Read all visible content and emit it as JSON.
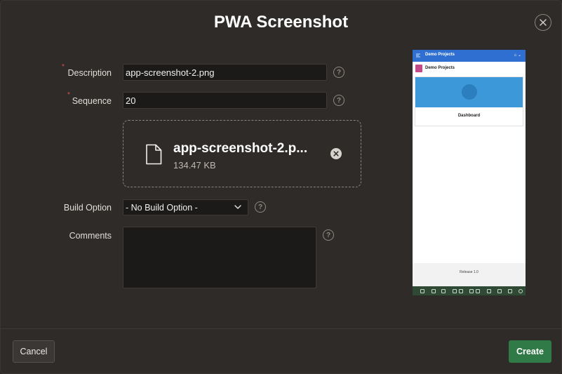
{
  "dialog": {
    "title": "PWA Screenshot",
    "close_icon": "close-icon"
  },
  "form": {
    "description": {
      "label": "Description",
      "value": "app-screenshot-2.png",
      "required": true
    },
    "sequence": {
      "label": "Sequence",
      "value": "20",
      "required": true
    },
    "file": {
      "name": "app-screenshot-2.p...",
      "size": "134.47 KB",
      "icon": "file-icon"
    },
    "build_option": {
      "label": "Build Option",
      "value": "- No Build Option -"
    },
    "comments": {
      "label": "Comments",
      "value": ""
    },
    "help_glyph": "?"
  },
  "preview": {
    "app_title": "Demo Projects",
    "user_glyph": "⌂ ⌄",
    "region_title": "Demo Projects",
    "card_label": "Dashboard",
    "release": "Release 1.0"
  },
  "buttons": {
    "cancel": "Cancel",
    "create": "Create"
  },
  "colors": {
    "background": "#2f2b28",
    "primary": "#2f7a47",
    "preview_header": "#2f6fd1",
    "required": "#d9534f"
  }
}
